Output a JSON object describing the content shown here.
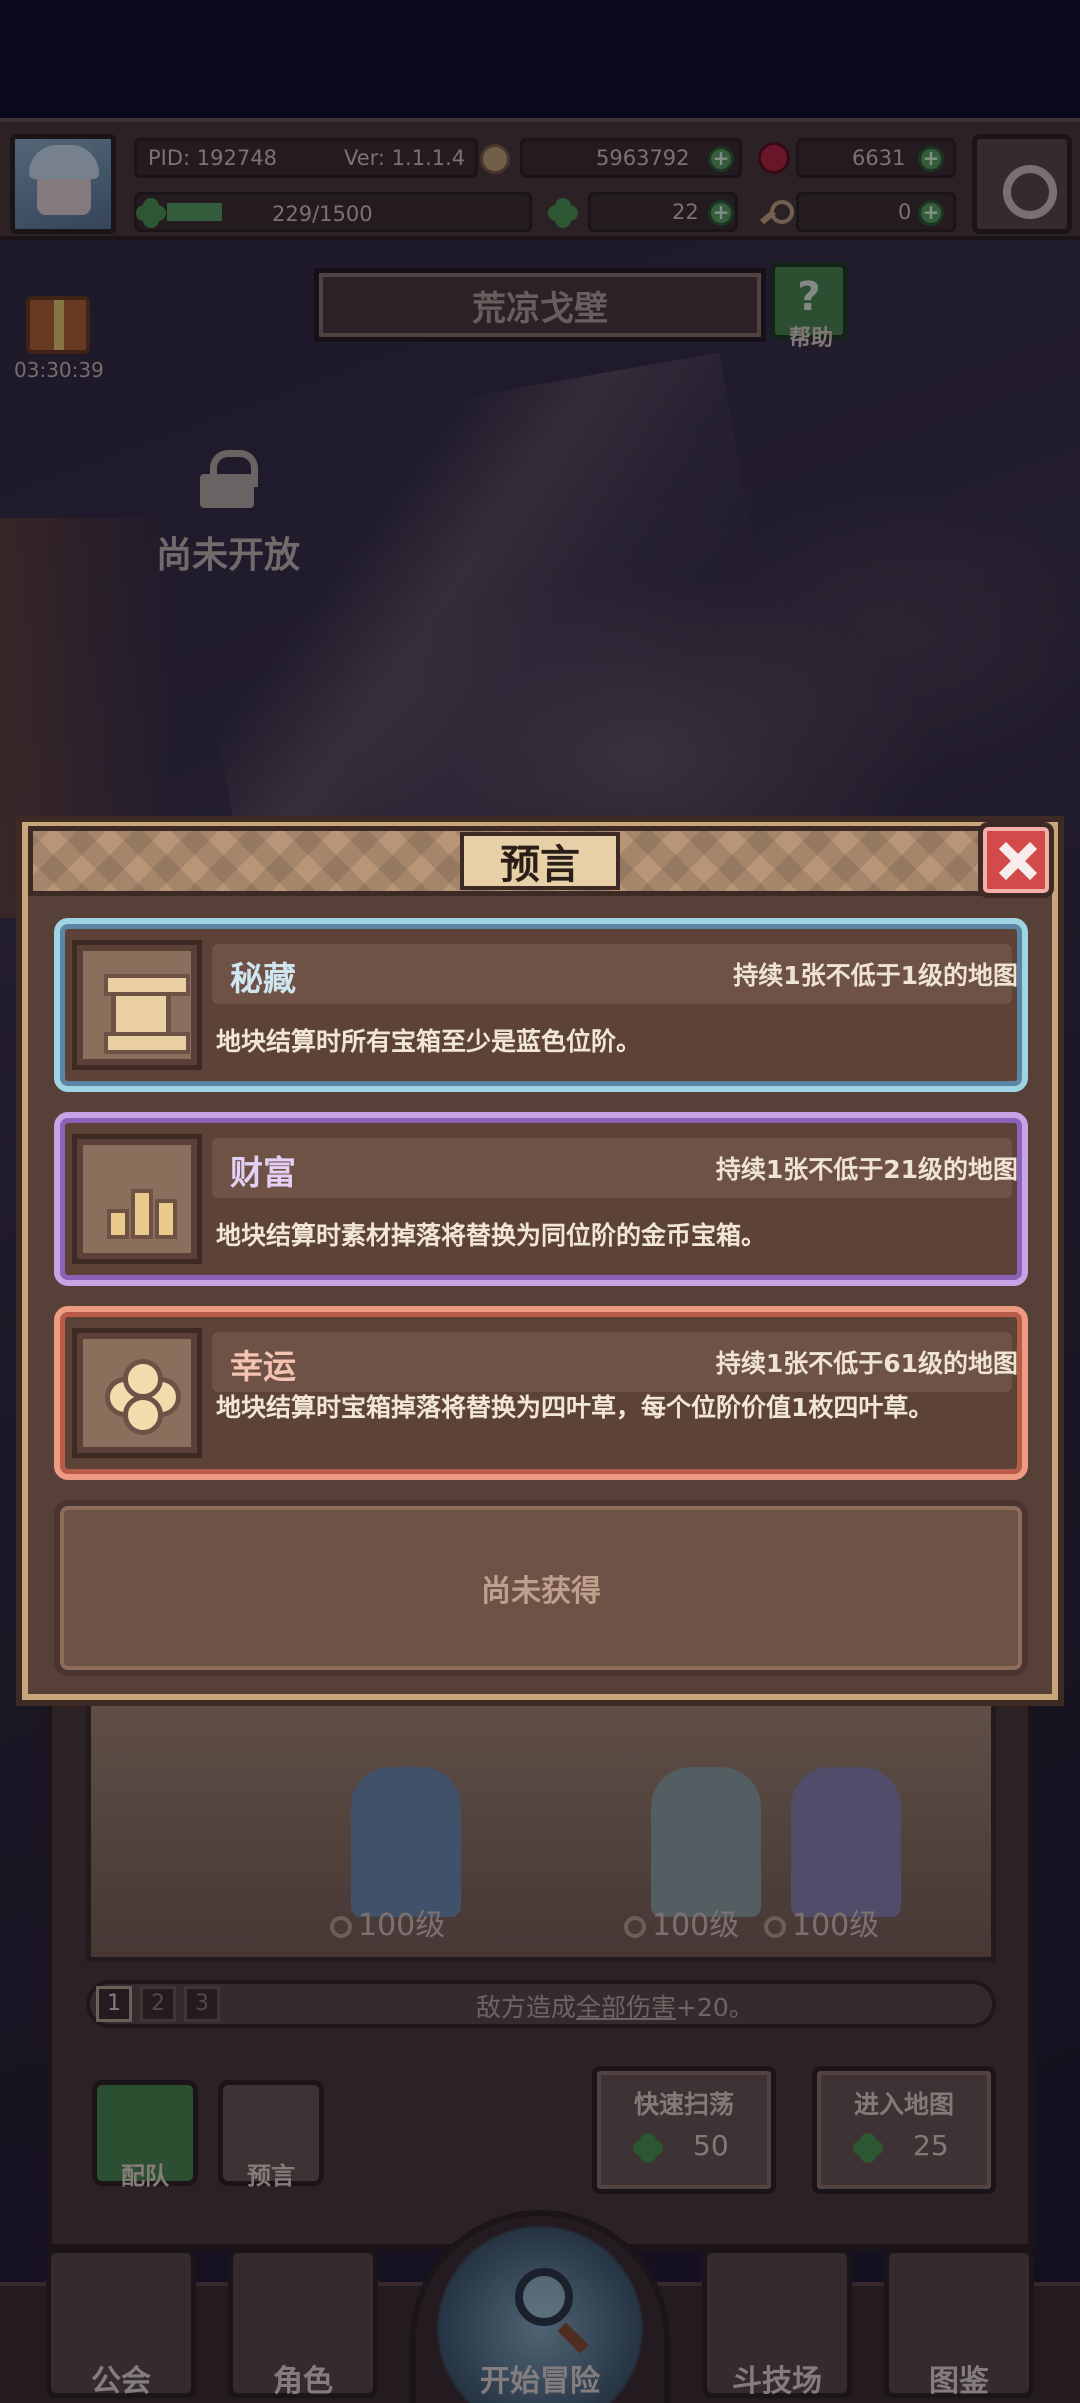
{
  "hud": {
    "pid": "PID: 192748",
    "version": "Ver: 1.1.1.4",
    "gold": "5963792",
    "gems": "6631",
    "energy": "229/1500",
    "energy_fill": 0.153,
    "clovers": "22",
    "keys": "0"
  },
  "map": {
    "title": "荒凉戈壁",
    "help_label": "帮助",
    "gift_timer": "03:30:39",
    "locked_label": "尚未开放"
  },
  "team": {
    "levels": [
      "100级",
      "100级",
      "100级"
    ],
    "stages": [
      "1",
      "2",
      "3"
    ],
    "stage_text_prefix": "敌方造成",
    "stage_text_underlined": "全部伤害",
    "stage_text_suffix": "+20。",
    "formation_label": "配队",
    "prophecy_label": "预言",
    "sweep": {
      "label": "快速扫荡",
      "cost": "50"
    },
    "enter": {
      "label": "进入地图",
      "cost": "25"
    }
  },
  "nav": {
    "guild": "公会",
    "character": "角色",
    "start": "开始冒险",
    "arena": "斗技场",
    "codex": "图鉴"
  },
  "modal": {
    "title": "预言",
    "cards": [
      {
        "name": "秘藏",
        "condition": "持续1张不低于1级的地图",
        "desc": "地块结算时所有宝箱至少是蓝色位阶。",
        "icon": "scroll-icon",
        "name_color": "#cfe6f0"
      },
      {
        "name": "财富",
        "condition": "持续1张不低于21级的地图",
        "desc": "地块结算时素材掉落将替换为同位阶的金币宝箱。",
        "icon": "coins-icon",
        "name_color": "#e4cff5"
      },
      {
        "name": "幸运",
        "condition": "持续1张不低于61级的地图",
        "desc": "地块结算时宝箱掉落将替换为四叶草，每个位阶价值1枚四叶草。",
        "icon": "clover-icon",
        "name_color": "#f6c3b3"
      }
    ],
    "locked_slot": "尚未获得"
  }
}
